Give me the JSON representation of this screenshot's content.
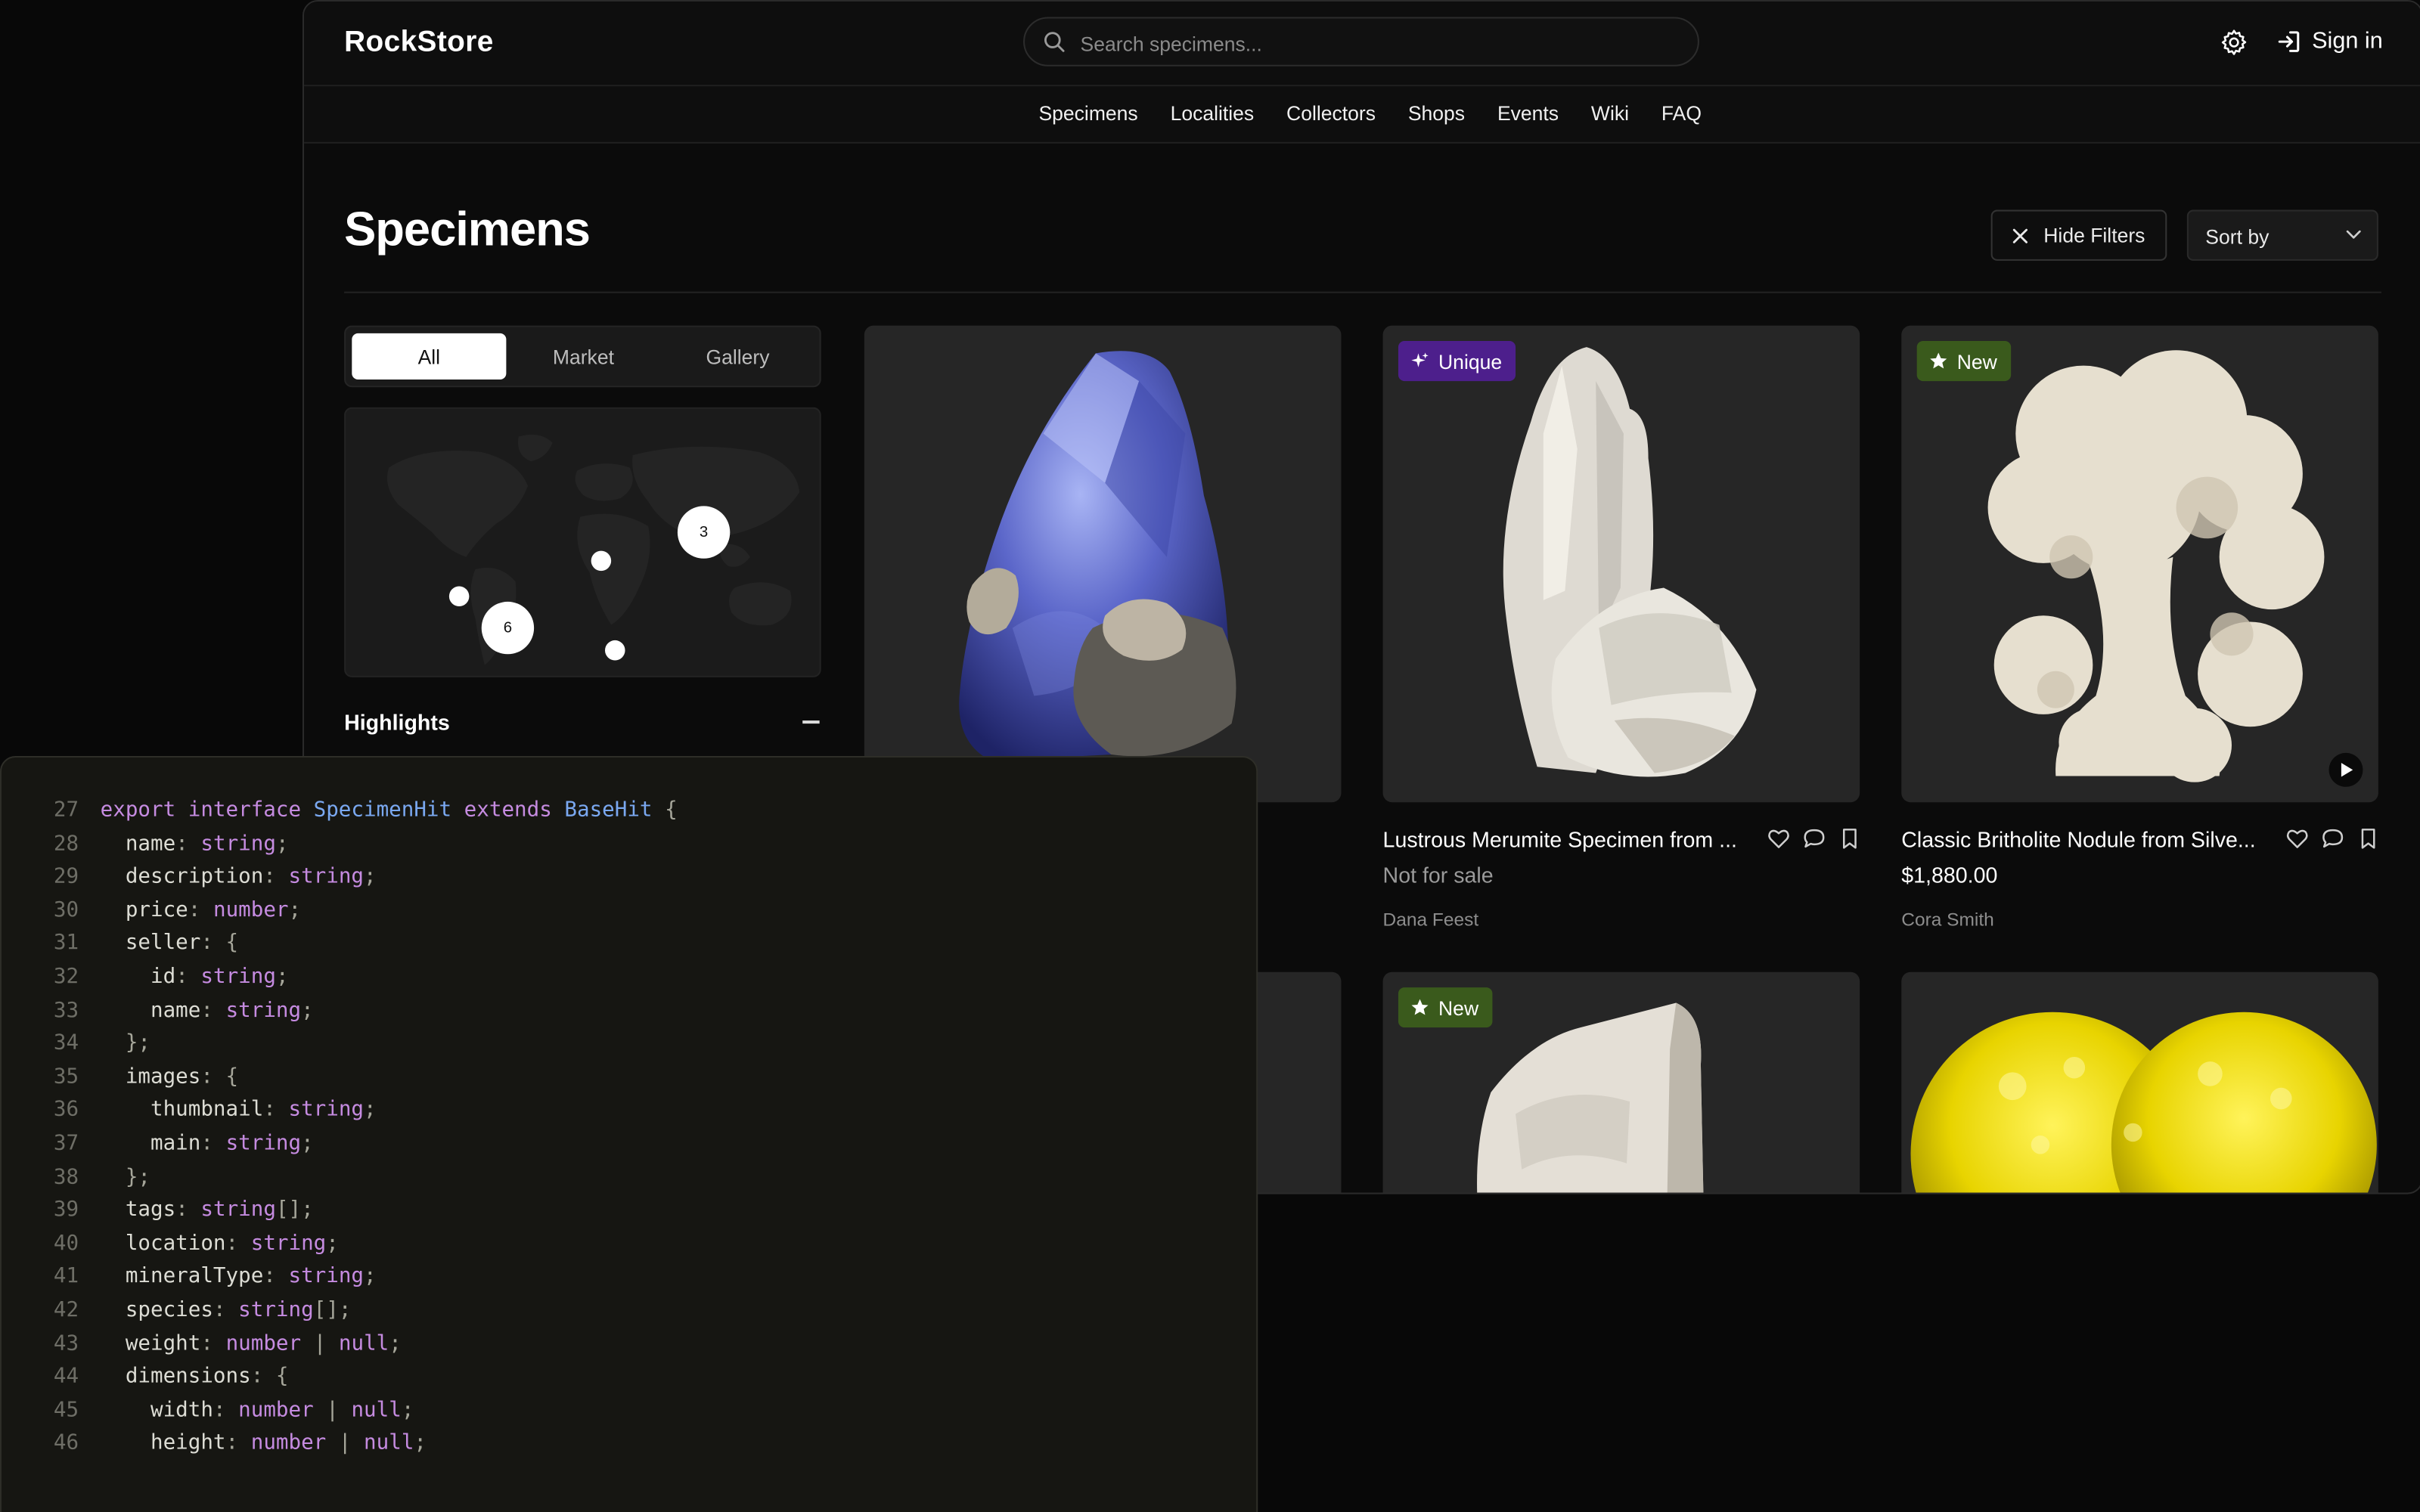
{
  "app": {
    "title": "RockStore",
    "search_placeholder": "Search specimens...",
    "sign_in": "Sign in"
  },
  "nav": {
    "items": [
      "Specimens",
      "Localities",
      "Collectors",
      "Shops",
      "Events",
      "Wiki",
      "FAQ"
    ]
  },
  "page": {
    "title": "Specimens",
    "hide_filters": "Hide Filters",
    "sort_by": "Sort by"
  },
  "filters": {
    "tabs": [
      {
        "label": "All",
        "active": true
      },
      {
        "label": "Market",
        "active": false
      },
      {
        "label": "Gallery",
        "active": false
      }
    ],
    "map_clusters": [
      "3",
      "6"
    ],
    "highlights_label": "Highlights"
  },
  "cards": [
    {
      "title": "",
      "price": "",
      "seller": "",
      "badge": "",
      "image": "blue-crystal"
    },
    {
      "title": "Lustrous Merumite Specimen from ...",
      "price": "Not for sale",
      "seller": "Dana Feest",
      "badge": "Unique",
      "image": "white-crystal"
    },
    {
      "title": "Classic Britholite Nodule from Silve...",
      "price": "$1,880.00",
      "seller": "Cora Smith",
      "badge": "New",
      "image": "cream-nodule"
    },
    {
      "title": "",
      "price": "",
      "seller": "",
      "badge": "New",
      "image": "pale-block"
    },
    {
      "title": "",
      "price": "",
      "seller": "",
      "badge": "",
      "image": "yellow-sulfur"
    }
  ],
  "code": {
    "lines": [
      {
        "n": "27",
        "tokens": [
          [
            "kw",
            "export interface "
          ],
          [
            "ty",
            "SpecimenHit"
          ],
          [
            "kw",
            " extends "
          ],
          [
            "ty",
            "BaseHit"
          ],
          [
            "p",
            " {"
          ]
        ]
      },
      {
        "n": "28",
        "tokens": [
          [
            "prop",
            "  name"
          ],
          [
            "p",
            ": "
          ],
          [
            "type",
            "string"
          ],
          [
            "p",
            ";"
          ]
        ]
      },
      {
        "n": "29",
        "tokens": [
          [
            "prop",
            "  description"
          ],
          [
            "p",
            ": "
          ],
          [
            "type",
            "string"
          ],
          [
            "p",
            ";"
          ]
        ]
      },
      {
        "n": "30",
        "tokens": [
          [
            "prop",
            "  price"
          ],
          [
            "p",
            ": "
          ],
          [
            "type",
            "number"
          ],
          [
            "p",
            ";"
          ]
        ]
      },
      {
        "n": "31",
        "tokens": [
          [
            "prop",
            "  seller"
          ],
          [
            "p",
            ": {"
          ]
        ]
      },
      {
        "n": "32",
        "tokens": [
          [
            "prop",
            "    id"
          ],
          [
            "p",
            ": "
          ],
          [
            "type",
            "string"
          ],
          [
            "p",
            ";"
          ]
        ]
      },
      {
        "n": "33",
        "tokens": [
          [
            "prop",
            "    name"
          ],
          [
            "p",
            ": "
          ],
          [
            "type",
            "string"
          ],
          [
            "p",
            ";"
          ]
        ]
      },
      {
        "n": "34",
        "tokens": [
          [
            "p",
            "  };"
          ]
        ]
      },
      {
        "n": "35",
        "tokens": [
          [
            "prop",
            "  images"
          ],
          [
            "p",
            ": {"
          ]
        ]
      },
      {
        "n": "36",
        "tokens": [
          [
            "prop",
            "    thumbnail"
          ],
          [
            "p",
            ": "
          ],
          [
            "type",
            "string"
          ],
          [
            "p",
            ";"
          ]
        ]
      },
      {
        "n": "37",
        "tokens": [
          [
            "prop",
            "    main"
          ],
          [
            "p",
            ": "
          ],
          [
            "type",
            "string"
          ],
          [
            "p",
            ";"
          ]
        ]
      },
      {
        "n": "38",
        "tokens": [
          [
            "p",
            "  };"
          ]
        ]
      },
      {
        "n": "39",
        "tokens": [
          [
            "prop",
            "  tags"
          ],
          [
            "p",
            ": "
          ],
          [
            "type",
            "string"
          ],
          [
            "p",
            "[];"
          ]
        ]
      },
      {
        "n": "40",
        "tokens": [
          [
            "prop",
            "  location"
          ],
          [
            "p",
            ": "
          ],
          [
            "type",
            "string"
          ],
          [
            "p",
            ";"
          ]
        ]
      },
      {
        "n": "41",
        "tokens": [
          [
            "prop",
            "  mineralType"
          ],
          [
            "p",
            ": "
          ],
          [
            "type",
            "string"
          ],
          [
            "p",
            ";"
          ]
        ]
      },
      {
        "n": "42",
        "tokens": [
          [
            "prop",
            "  species"
          ],
          [
            "p",
            ": "
          ],
          [
            "type",
            "string"
          ],
          [
            "p",
            "[];"
          ]
        ]
      },
      {
        "n": "43",
        "tokens": [
          [
            "prop",
            "  weight"
          ],
          [
            "p",
            ": "
          ],
          [
            "type",
            "number"
          ],
          [
            "p",
            " | "
          ],
          [
            "type",
            "null"
          ],
          [
            "p",
            ";"
          ]
        ]
      },
      {
        "n": "44",
        "tokens": [
          [
            "prop",
            "  dimensions"
          ],
          [
            "p",
            ": {"
          ]
        ]
      },
      {
        "n": "45",
        "tokens": [
          [
            "prop",
            "    width"
          ],
          [
            "p",
            ": "
          ],
          [
            "type",
            "number"
          ],
          [
            "p",
            " | "
          ],
          [
            "type",
            "null"
          ],
          [
            "p",
            ";"
          ]
        ]
      },
      {
        "n": "46",
        "tokens": [
          [
            "prop",
            "    height"
          ],
          [
            "p",
            ": "
          ],
          [
            "type",
            "number"
          ],
          [
            "p",
            " | "
          ],
          [
            "type",
            "null"
          ],
          [
            "p",
            ";"
          ]
        ]
      }
    ]
  }
}
